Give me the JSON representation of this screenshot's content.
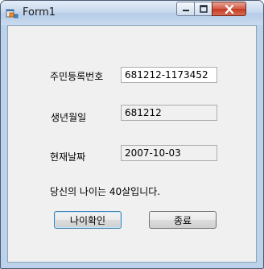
{
  "window": {
    "title": "Form1",
    "icon": "form-app-icon",
    "controls": {
      "minimize": "minimize-icon",
      "maximize": "maximize-icon",
      "close": "close-icon"
    }
  },
  "form": {
    "ssn_label": "주민등록번호",
    "ssn_value": "681212-1173452",
    "birth_label": "생년월일",
    "birth_value": "681212",
    "today_label": "현재날짜",
    "today_value": "2007-10-03",
    "result_text": "당신의 나이는 40살입니다."
  },
  "buttons": {
    "check_age": "나이확인",
    "exit": "종료"
  },
  "colors": {
    "titlebar": "#c7d9ee",
    "close_button": "#c33c22",
    "client_bg": "#f0f0f0"
  }
}
